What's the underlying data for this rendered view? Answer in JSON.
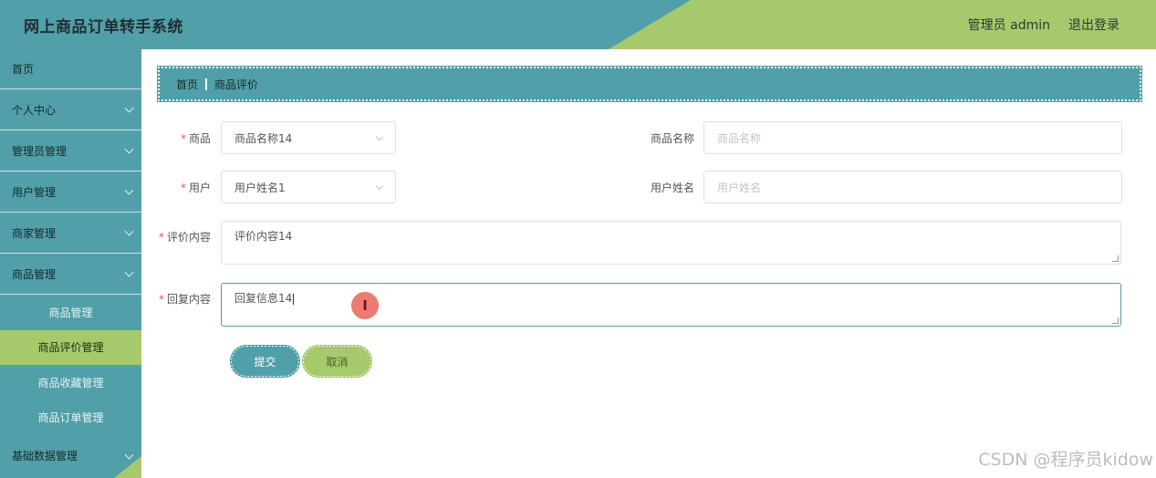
{
  "header": {
    "title": "网上商品订单转手系统",
    "user_label": "管理员 admin",
    "logout_label": "退出登录"
  },
  "sidebar": {
    "items": [
      {
        "label": "首页"
      },
      {
        "label": "个人中心"
      },
      {
        "label": "管理员管理"
      },
      {
        "label": "用户管理"
      },
      {
        "label": "商家管理"
      },
      {
        "label": "商品管理"
      }
    ],
    "sub_items": [
      {
        "label": "商品管理"
      },
      {
        "label": "商品评价管理"
      },
      {
        "label": "商品收藏管理"
      },
      {
        "label": "商品订单管理"
      }
    ],
    "last_item": {
      "label": "基础数据管理"
    }
  },
  "breadcrumb": {
    "home": "首页",
    "current": "商品评价"
  },
  "form": {
    "goods": {
      "label": "商品",
      "value": "商品名称14"
    },
    "goods_name": {
      "label": "商品名称",
      "placeholder": "商品名称"
    },
    "user": {
      "label": "用户",
      "value": "用户姓名1"
    },
    "user_name": {
      "label": "用户姓名",
      "placeholder": "用户姓名"
    },
    "content": {
      "label": "评价内容",
      "value": "评价内容14"
    },
    "reply": {
      "label": "回复内容",
      "value": "回复信息14"
    },
    "required_mark": "*"
  },
  "buttons": {
    "submit": "提交",
    "cancel": "取消"
  },
  "cursor_glyph": "I",
  "watermark": "CSDN @程序员kidow",
  "colors": {
    "teal": "#519fa8",
    "green": "#a6c96b",
    "required": "#e45656"
  }
}
